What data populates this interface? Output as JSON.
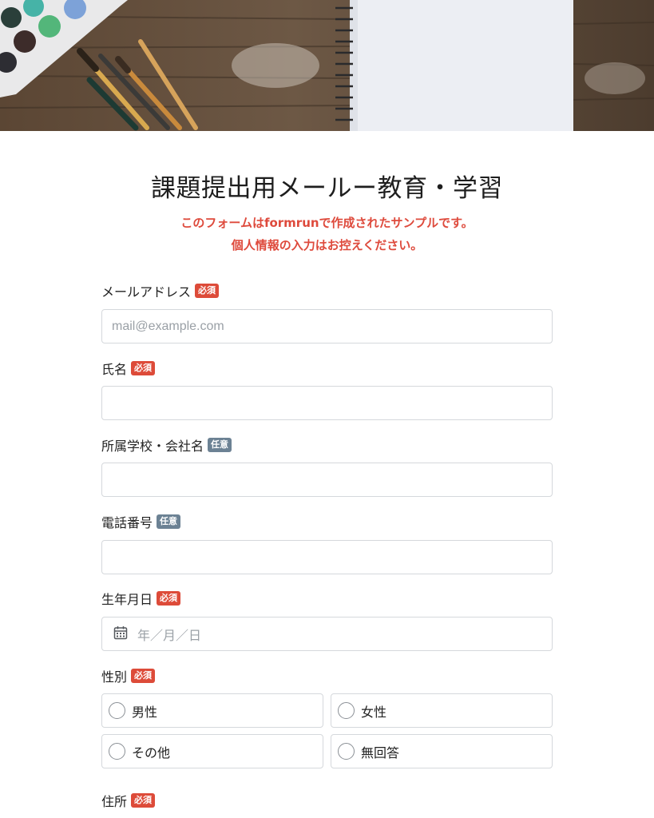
{
  "form": {
    "title": "課題提出用メールー教育・学習",
    "notice_line1": "このフォームはformrunで作成されたサンプルです。",
    "notice_line2": "個人情報の入力はお控えください。"
  },
  "badges": {
    "required": "必須",
    "optional": "任意"
  },
  "fields": {
    "email": {
      "label": "メールアドレス",
      "placeholder": "mail@example.com",
      "value": ""
    },
    "name": {
      "label": "氏名",
      "value": ""
    },
    "affiliation": {
      "label": "所属学校・会社名",
      "value": ""
    },
    "phone": {
      "label": "電話番号",
      "value": ""
    },
    "birthdate": {
      "label": "生年月日",
      "placeholder": "年／月／日"
    },
    "gender": {
      "label": "性別",
      "options": [
        "男性",
        "女性",
        "その他",
        "無回答"
      ]
    },
    "address": {
      "label": "住所"
    }
  },
  "icons": {
    "calendar": "calendar-icon"
  },
  "colors": {
    "required_badge": "#dd4b39",
    "optional_badge": "#6c8294",
    "notice_text": "#de4a3c"
  }
}
